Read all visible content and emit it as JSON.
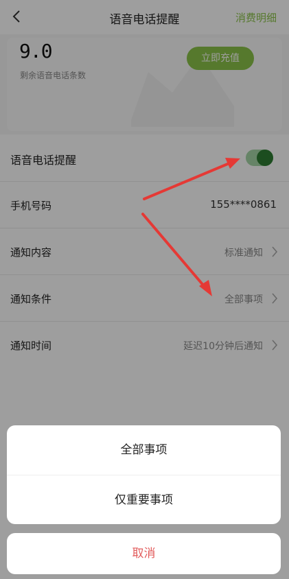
{
  "header": {
    "title": "语音电话提醒",
    "right_link": "消费明细"
  },
  "balance": {
    "value": "9.0",
    "label": "剩余语音电话条数",
    "recharge_label": "立即充值"
  },
  "settings": {
    "toggle_row": {
      "label": "语音电话提醒",
      "enabled": true
    },
    "phone": {
      "label": "手机号码",
      "value": "155****0861"
    },
    "content": {
      "label": "通知内容",
      "value": "标准通知"
    },
    "condition": {
      "label": "通知条件",
      "value": "全部事项"
    },
    "time": {
      "label": "通知时间",
      "value": "延迟10分钟后通知"
    }
  },
  "action_sheet": {
    "options": [
      "全部事项",
      "仅重要事项"
    ],
    "cancel_label": "取消"
  },
  "colors": {
    "accent": "#8bc34a",
    "toggle_on": "#2e7d32",
    "cancel": "#e25b5b",
    "arrow": "#e53935"
  },
  "icons": {
    "back": "chevron-left-icon",
    "row_chevron": "chevron-right-icon"
  }
}
